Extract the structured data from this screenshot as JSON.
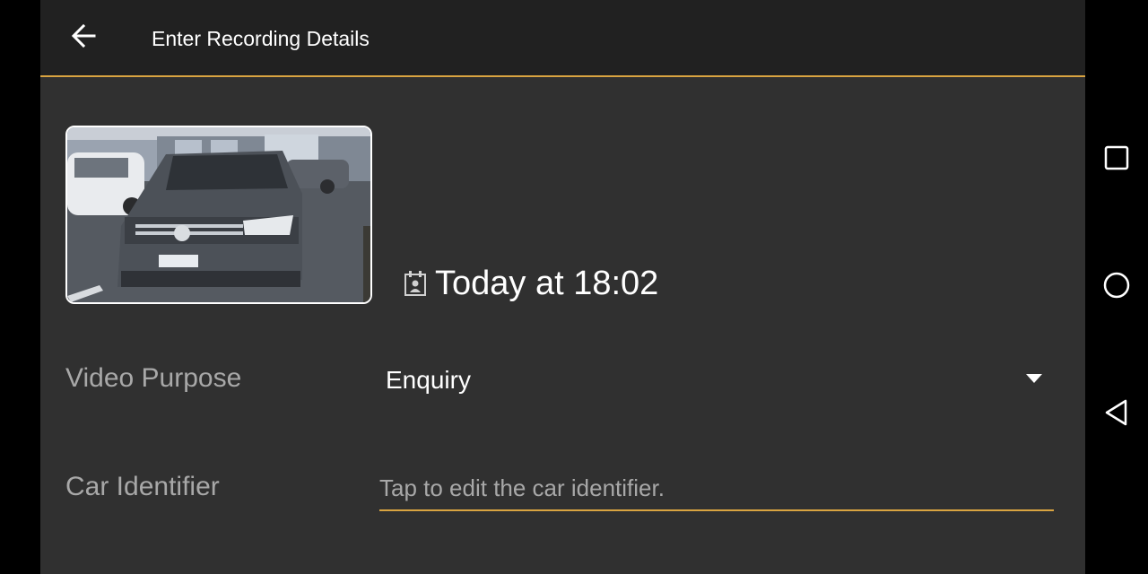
{
  "appbar": {
    "title": "Enter Recording Details",
    "back_icon": "arrow-left-icon"
  },
  "recording": {
    "thumbnail_alt": "recording-thumbnail",
    "date_icon": "calendar-icon",
    "date_text": "Today at 18:02"
  },
  "form": {
    "video_purpose_label": "Video Purpose",
    "video_purpose_value": "Enquiry",
    "car_identifier_label": "Car Identifier",
    "car_identifier_value": "",
    "car_identifier_placeholder": "Tap to edit the car identifier."
  },
  "system_nav": {
    "recent_icon": "square-icon",
    "home_icon": "circle-icon",
    "back_icon": "triangle-back-icon"
  },
  "colors": {
    "background": "#303030",
    "appbar": "#212121",
    "accent": "#d9a441",
    "text_primary": "#ffffff",
    "text_secondary": "#a8a8a8"
  }
}
